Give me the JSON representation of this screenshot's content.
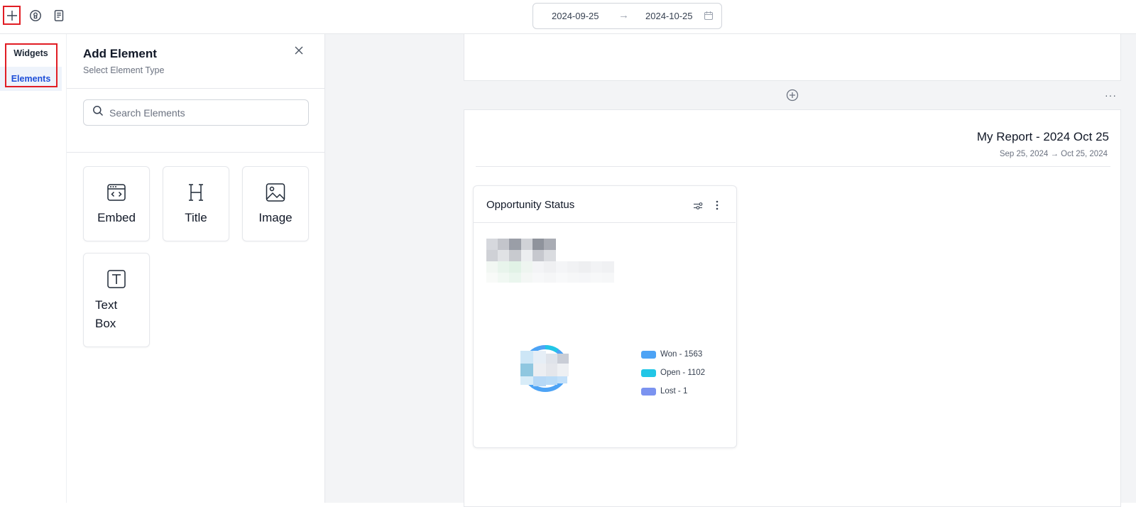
{
  "topbar": {
    "date_start": "2024-09-25",
    "date_arrow": "→",
    "date_end": "2024-10-25"
  },
  "rail": {
    "items": [
      {
        "label": "Widgets"
      },
      {
        "label": "Elements"
      }
    ]
  },
  "panel": {
    "title": "Add Element",
    "subtitle": "Select Element Type",
    "search_placeholder": "Search Elements",
    "elements": [
      {
        "label": "Embed",
        "icon": "embed-icon"
      },
      {
        "label": "Title",
        "icon": "heading-icon"
      },
      {
        "label": "Image",
        "icon": "image-icon"
      },
      {
        "label": "Text Box",
        "icon": "text-box-icon"
      }
    ]
  },
  "report": {
    "title": "My Report - 2024 Oct 25",
    "date_range": "Sep 25, 2024 → Oct 25, 2024",
    "more_label": "···"
  },
  "widget": {
    "title": "Opportunity Status",
    "legend": [
      {
        "label": "Won - 1563",
        "color": "#4da3f5"
      },
      {
        "label": "Open - 1102",
        "color": "#22c6e6"
      },
      {
        "label": "Lost - 1",
        "color": "#7b93f0"
      }
    ]
  },
  "colors": {
    "accent": "#1d4ed8",
    "highlight": "#e11d24"
  }
}
